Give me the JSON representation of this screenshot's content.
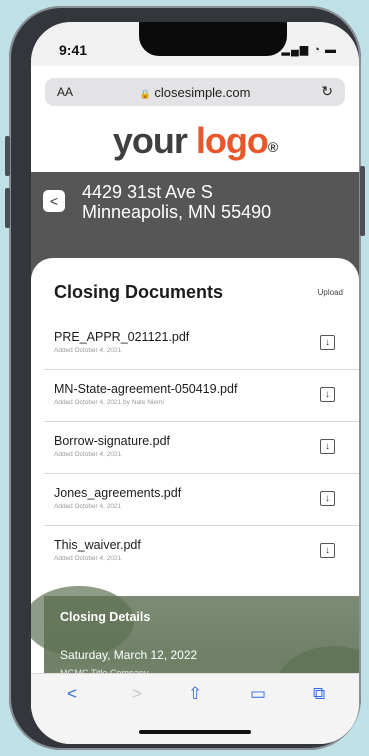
{
  "status": {
    "time": "9:41",
    "icons": "▂▄▆ ◔ ▬"
  },
  "browser": {
    "aa_label": "AA",
    "url": "closesimple.com",
    "lock_glyph": "🔒",
    "reload_glyph": "↻"
  },
  "logo": {
    "part1": "your",
    "part2": "logo",
    "reg": "®"
  },
  "property": {
    "back_glyph": "<",
    "address_line1": "4429 31st Ave S",
    "address_line2": "Minneapolis, MN 55490"
  },
  "documents": {
    "title": "Closing Documents",
    "upload_label": "Upload",
    "items": [
      {
        "name": "PRE_APPR_021121.pdf",
        "meta": "Added October 4, 2021"
      },
      {
        "name": "MN-State-agreement-050419.pdf",
        "meta": "Added October 4, 2021 by Nate Niemi"
      },
      {
        "name": "Borrow-signature.pdf",
        "meta": "Added October 4, 2021"
      },
      {
        "name": "Jones_agreements.pdf",
        "meta": "Added October 4, 2021"
      },
      {
        "name": "This_waiver.pdf",
        "meta": "Added October 4, 2021"
      }
    ],
    "download_glyph": "↓"
  },
  "closing": {
    "title": "Closing Details",
    "date": "Saturday, March 12, 2022",
    "company": "MGMC Title Company"
  },
  "toolbar": {
    "back": "<",
    "forward": ">",
    "share": "⇧",
    "bookmarks": "▭",
    "tabs": "⧉"
  },
  "colors": {
    "brand_orange": "#e8562a",
    "header_band": "#565656",
    "link_blue": "#2f6ce0"
  }
}
